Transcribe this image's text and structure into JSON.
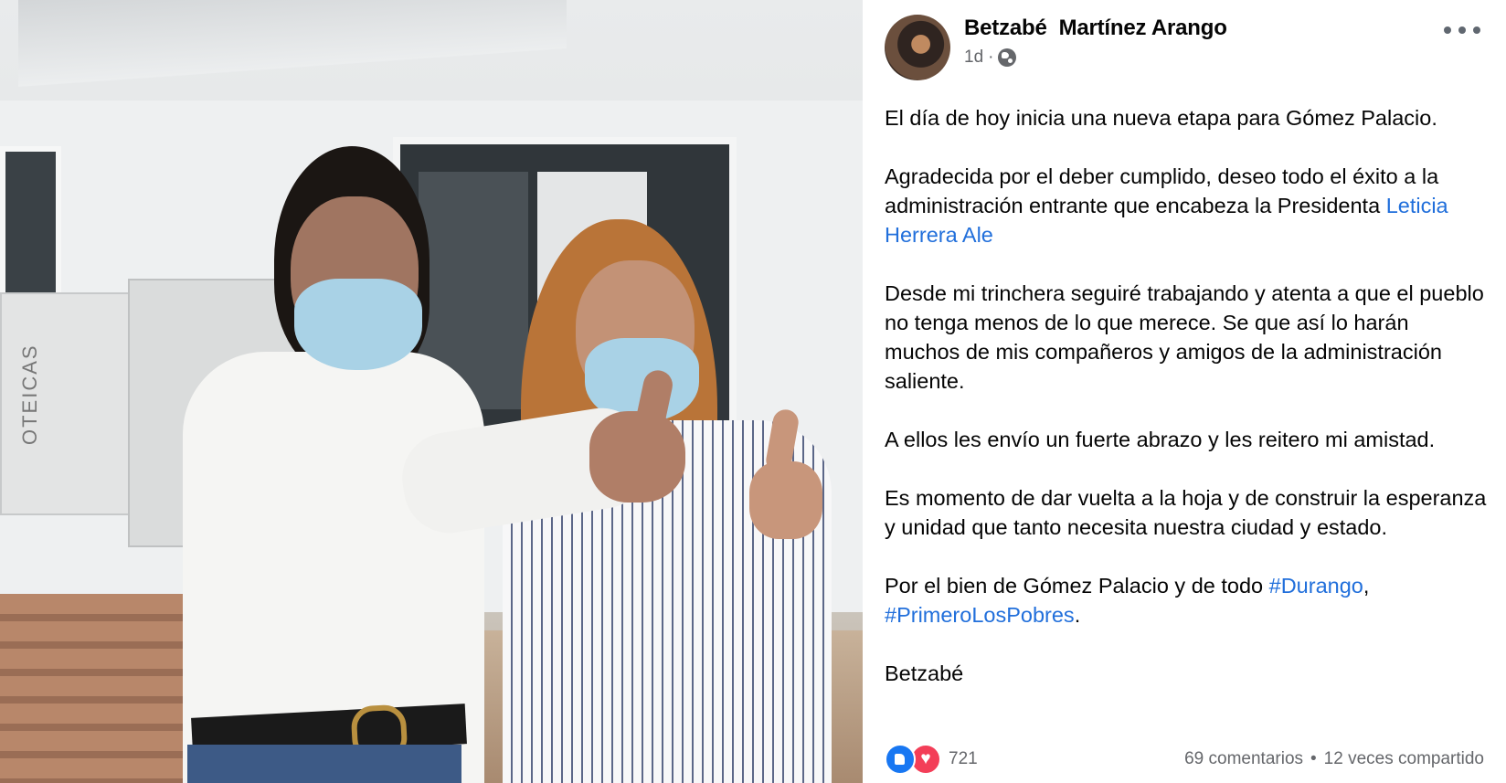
{
  "post": {
    "author": "Betzabé  Martínez Arango",
    "timestamp": "1d",
    "meta_separator": "·",
    "audience_icon": "globe-icon",
    "more_icon": "more-horizontal-icon",
    "paragraphs": {
      "p1": "El día de hoy inicia una nueva etapa para  Gómez Palacio.",
      "p2_text": "Agradecida por el deber cumplido, deseo todo el éxito a la administración entrante que encabeza la Presidenta ",
      "p2_link": "Leticia Herrera Ale",
      "p3": "Desde mi trinchera seguiré trabajando y atenta a que el pueblo no tenga menos de lo que merece. Se que así lo harán muchos de mis compañeros y amigos  de la administración saliente.",
      "p4": "A ellos les envío un fuerte abrazo y les reitero mi amistad.",
      "p5": "Es momento de dar vuelta a la hoja y de construir la esperanza y unidad que tanto necesita nuestra ciudad y estado.",
      "p6_text": "Por el bien de Gómez Palacio y de todo ",
      "p6_tag1": "#Durango",
      "p6_comma": ",",
      "p6_tag2": "#PrimeroLosPobres",
      "p6_end": ".",
      "p7": "Betzabé"
    },
    "reactions": {
      "icons": [
        "like-icon",
        "love-icon"
      ],
      "count": "721"
    },
    "comments": "69 comentarios",
    "separator": "•",
    "shares": "12 veces compartido"
  },
  "photo": {
    "sign_text": "OTEICAS"
  },
  "colors": {
    "link": "#216fdb",
    "like": "#1877f2",
    "love": "#f33e58",
    "meta": "#65676b"
  }
}
